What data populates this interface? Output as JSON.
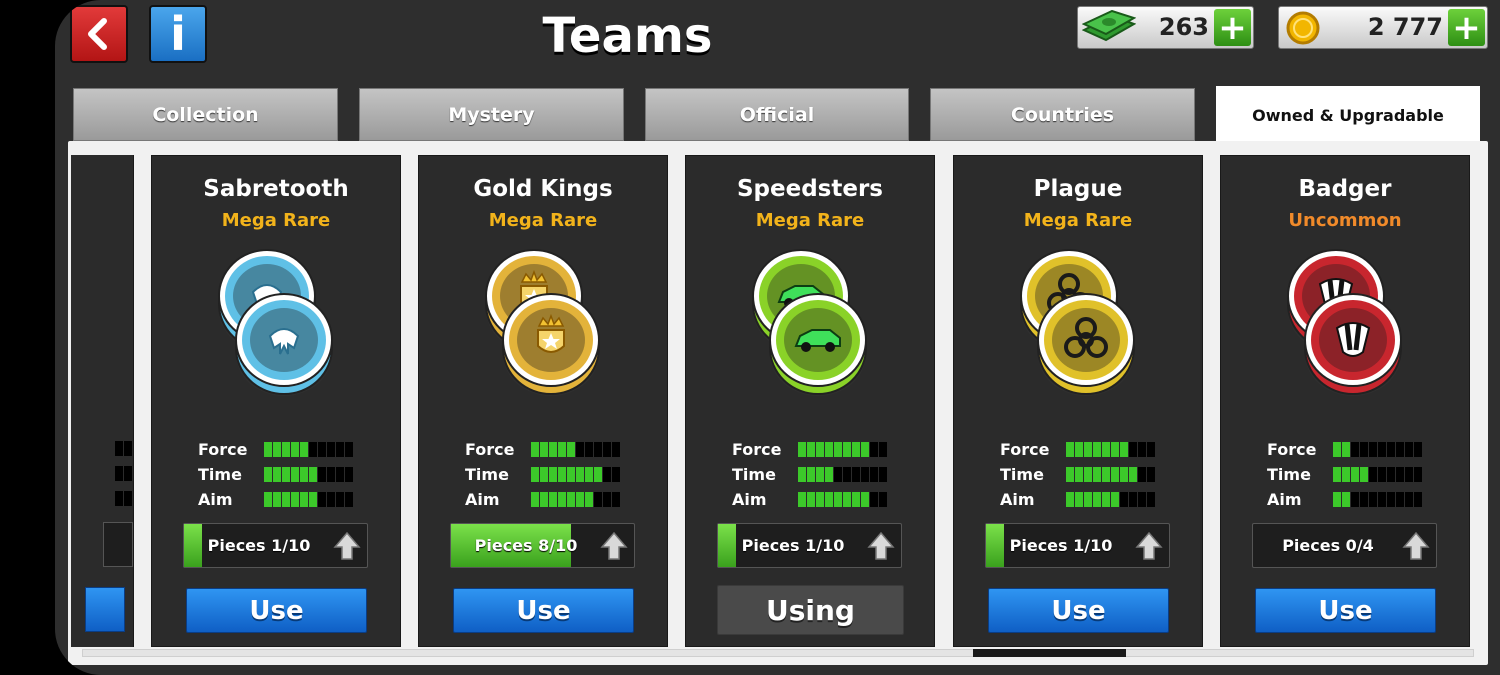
{
  "header": {
    "title": "Teams",
    "back_icon": "back-arrow-icon",
    "info_icon": "info-icon",
    "info_glyph": "i"
  },
  "currency": {
    "cash": {
      "value": "263",
      "icon": "cash-stack-icon",
      "plus": "+"
    },
    "coins": {
      "value": "2 777",
      "icon": "gold-coin-icon",
      "plus": "+"
    }
  },
  "tabs": [
    {
      "label": "Collection",
      "active": false
    },
    {
      "label": "Mystery",
      "active": false
    },
    {
      "label": "Official",
      "active": false
    },
    {
      "label": "Countries",
      "active": false
    },
    {
      "label": "Owned & Upgradable",
      "active": true
    }
  ],
  "colors": {
    "mega_rare": "#f2b31b",
    "uncommon": "#f08a2a",
    "stat_on": "#3cc92a",
    "button_blue": "#1a78dc"
  },
  "stat_labels": [
    "Force",
    "Time",
    "Aim"
  ],
  "stat_max": 10,
  "cards": [
    {
      "name": "Sabretooth",
      "rarity": "Mega Rare",
      "rarity_color": "#f2b31b",
      "badge": "sabretooth-skull-badge-icon",
      "badge_color": "#5fc0e6",
      "stats": [
        5,
        6,
        6
      ],
      "pieces_text": "Pieces 1/10",
      "pieces_fraction": 0.1,
      "button": "Use",
      "in_use": false
    },
    {
      "name": "Gold Kings",
      "rarity": "Mega Rare",
      "rarity_color": "#f2b31b",
      "badge": "crown-star-badge-icon",
      "badge_color": "#e3b33a",
      "stats": [
        5,
        8,
        7
      ],
      "pieces_text": "Pieces 8/10",
      "pieces_fraction": 0.8,
      "button": "Use",
      "in_use": false
    },
    {
      "name": "Speedsters",
      "rarity": "Mega Rare",
      "rarity_color": "#f2b31b",
      "badge": "race-car-badge-icon",
      "badge_color": "#8ad228",
      "stats": [
        8,
        4,
        8
      ],
      "pieces_text": "Pieces 1/10",
      "pieces_fraction": 0.1,
      "button": "Using",
      "in_use": true
    },
    {
      "name": "Plague",
      "rarity": "Mega Rare",
      "rarity_color": "#f2b31b",
      "badge": "biohazard-badge-icon",
      "badge_color": "#e0c12a",
      "stats": [
        7,
        8,
        6
      ],
      "pieces_text": "Pieces 1/10",
      "pieces_fraction": 0.1,
      "button": "Use",
      "in_use": false
    },
    {
      "name": "Badger",
      "rarity": "Uncommon",
      "rarity_color": "#f08a2a",
      "badge": "badger-badge-icon",
      "badge_color": "#c8262e",
      "stats": [
        2,
        4,
        2
      ],
      "pieces_text": "Pieces 0/4",
      "pieces_fraction": 0.0,
      "button": "Use",
      "in_use": false
    }
  ]
}
